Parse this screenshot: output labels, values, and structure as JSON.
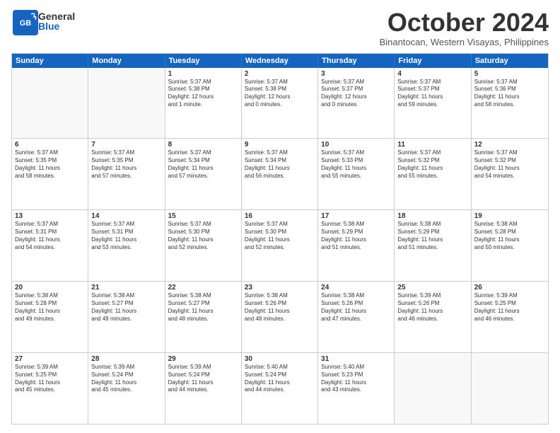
{
  "header": {
    "logo_general": "General",
    "logo_blue": "Blue",
    "month": "October 2024",
    "location": "Binantocan, Western Visayas, Philippines"
  },
  "days_of_week": [
    "Sunday",
    "Monday",
    "Tuesday",
    "Wednesday",
    "Thursday",
    "Friday",
    "Saturday"
  ],
  "rows": [
    [
      {
        "day": "",
        "text": ""
      },
      {
        "day": "",
        "text": ""
      },
      {
        "day": "1",
        "text": "Sunrise: 5:37 AM\nSunset: 5:38 PM\nDaylight: 12 hours\nand 1 minute."
      },
      {
        "day": "2",
        "text": "Sunrise: 5:37 AM\nSunset: 5:38 PM\nDaylight: 12 hours\nand 0 minutes."
      },
      {
        "day": "3",
        "text": "Sunrise: 5:37 AM\nSunset: 5:37 PM\nDaylight: 12 hours\nand 0 minutes."
      },
      {
        "day": "4",
        "text": "Sunrise: 5:37 AM\nSunset: 5:37 PM\nDaylight: 11 hours\nand 59 minutes."
      },
      {
        "day": "5",
        "text": "Sunrise: 5:37 AM\nSunset: 5:36 PM\nDaylight: 11 hours\nand 58 minutes."
      }
    ],
    [
      {
        "day": "6",
        "text": "Sunrise: 5:37 AM\nSunset: 5:35 PM\nDaylight: 11 hours\nand 58 minutes."
      },
      {
        "day": "7",
        "text": "Sunrise: 5:37 AM\nSunset: 5:35 PM\nDaylight: 11 hours\nand 57 minutes."
      },
      {
        "day": "8",
        "text": "Sunrise: 5:37 AM\nSunset: 5:34 PM\nDaylight: 11 hours\nand 57 minutes."
      },
      {
        "day": "9",
        "text": "Sunrise: 5:37 AM\nSunset: 5:34 PM\nDaylight: 11 hours\nand 56 minutes."
      },
      {
        "day": "10",
        "text": "Sunrise: 5:37 AM\nSunset: 5:33 PM\nDaylight: 11 hours\nand 55 minutes."
      },
      {
        "day": "11",
        "text": "Sunrise: 5:37 AM\nSunset: 5:32 PM\nDaylight: 11 hours\nand 55 minutes."
      },
      {
        "day": "12",
        "text": "Sunrise: 5:37 AM\nSunset: 5:32 PM\nDaylight: 11 hours\nand 54 minutes."
      }
    ],
    [
      {
        "day": "13",
        "text": "Sunrise: 5:37 AM\nSunset: 5:31 PM\nDaylight: 11 hours\nand 54 minutes."
      },
      {
        "day": "14",
        "text": "Sunrise: 5:37 AM\nSunset: 5:31 PM\nDaylight: 11 hours\nand 53 minutes."
      },
      {
        "day": "15",
        "text": "Sunrise: 5:37 AM\nSunset: 5:30 PM\nDaylight: 11 hours\nand 52 minutes."
      },
      {
        "day": "16",
        "text": "Sunrise: 5:37 AM\nSunset: 5:30 PM\nDaylight: 11 hours\nand 52 minutes."
      },
      {
        "day": "17",
        "text": "Sunrise: 5:38 AM\nSunset: 5:29 PM\nDaylight: 11 hours\nand 51 minutes."
      },
      {
        "day": "18",
        "text": "Sunrise: 5:38 AM\nSunset: 5:29 PM\nDaylight: 11 hours\nand 51 minutes."
      },
      {
        "day": "19",
        "text": "Sunrise: 5:38 AM\nSunset: 5:28 PM\nDaylight: 11 hours\nand 50 minutes."
      }
    ],
    [
      {
        "day": "20",
        "text": "Sunrise: 5:38 AM\nSunset: 5:28 PM\nDaylight: 11 hours\nand 49 minutes."
      },
      {
        "day": "21",
        "text": "Sunrise: 5:38 AM\nSunset: 5:27 PM\nDaylight: 11 hours\nand 49 minutes."
      },
      {
        "day": "22",
        "text": "Sunrise: 5:38 AM\nSunset: 5:27 PM\nDaylight: 11 hours\nand 48 minutes."
      },
      {
        "day": "23",
        "text": "Sunrise: 5:38 AM\nSunset: 5:26 PM\nDaylight: 11 hours\nand 48 minutes."
      },
      {
        "day": "24",
        "text": "Sunrise: 5:38 AM\nSunset: 5:26 PM\nDaylight: 11 hours\nand 47 minutes."
      },
      {
        "day": "25",
        "text": "Sunrise: 5:39 AM\nSunset: 5:26 PM\nDaylight: 11 hours\nand 46 minutes."
      },
      {
        "day": "26",
        "text": "Sunrise: 5:39 AM\nSunset: 5:25 PM\nDaylight: 11 hours\nand 46 minutes."
      }
    ],
    [
      {
        "day": "27",
        "text": "Sunrise: 5:39 AM\nSunset: 5:25 PM\nDaylight: 11 hours\nand 45 minutes."
      },
      {
        "day": "28",
        "text": "Sunrise: 5:39 AM\nSunset: 5:24 PM\nDaylight: 11 hours\nand 45 minutes."
      },
      {
        "day": "29",
        "text": "Sunrise: 5:39 AM\nSunset: 5:24 PM\nDaylight: 11 hours\nand 44 minutes."
      },
      {
        "day": "30",
        "text": "Sunrise: 5:40 AM\nSunset: 5:24 PM\nDaylight: 11 hours\nand 44 minutes."
      },
      {
        "day": "31",
        "text": "Sunrise: 5:40 AM\nSunset: 5:23 PM\nDaylight: 11 hours\nand 43 minutes."
      },
      {
        "day": "",
        "text": ""
      },
      {
        "day": "",
        "text": ""
      }
    ]
  ]
}
